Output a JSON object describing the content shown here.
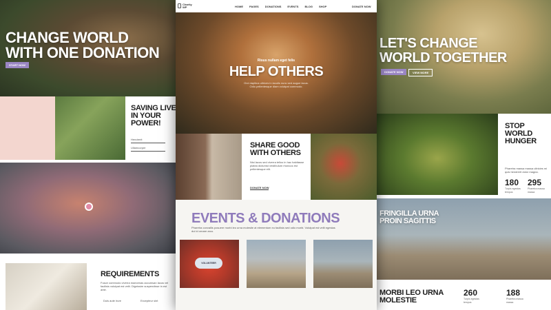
{
  "left": {
    "hero_title": "CHANGE WORLD\nWITH ONE DONATION",
    "hero_btn": "START NOW",
    "saving_title": "SAVING LIVE\nIN YOUR\nPOWER!",
    "field1": "Hendrerit",
    "field2": "Ullamcorper",
    "req_title": "REQUIREMENTS",
    "req_text": "Fusce commodo viverra maecenas accumsan lacus vel facilisis volutpat est velit. Dignissim suspendisse in est ante.",
    "bullet1": "Duis aute irure",
    "bullet2": "Excepteur sint"
  },
  "center": {
    "logo_line1": "Charity",
    "logo_line2": "WP",
    "nav": [
      "HOME",
      "PAGES",
      "DONATIONS",
      "EVENTS",
      "BLOG",
      "SHOP"
    ],
    "donate": "DONATE NOW",
    "hero_eyebrow": "Risus nullam eget felis",
    "hero_title": "HELP OTHERS",
    "hero_text": "Orci dapibus ultrices in iaculis nunc sed augue lacus. Odio pellentesque diam volutpat commodo.",
    "share_title": "SHARE GOOD\nWITH OTHERS",
    "share_text": "Nisi lacus sed viverra tellus in hac habitasse platea dictumst vestibulum rhoncus est pellentesque elit.",
    "share_btn": "DONATE NOW",
    "events_title": "EVENTS & DONATIONS",
    "events_text": "Pharetra convallis posuere morbi leo urna molestie at elementum eu facilisis sed odio morbi. Volutpat est velit egestas dui id ornare arcu.",
    "volunteer": "VOLUNTEER"
  },
  "right": {
    "hero_title": "LET'S CHANGE\nWORLD TOGETHER",
    "hero_btn1": "DONATE NOW",
    "hero_btn2": "VIEW MORE",
    "hunger_title": "STOP\nWORLD\nHUNGER",
    "hunger_text": "Pharetra massa massa ultricies mi quis hendrerit dolor magna.",
    "stat1_num": "180",
    "stat1_lbl": "Turpis egestas tempus",
    "stat2_num": "295",
    "stat2_lbl": "Pharetra massa massa",
    "fringilla_title": "FRINGILLA URNA\nPROIN SAGITTIS",
    "morbi_title": "MORBI LEO URNA\nMOLESTIE",
    "stat3_num": "260",
    "stat3_lbl": "Turpis egestas tempus",
    "stat4_num": "188",
    "stat4_lbl": "Pharetra massa massa"
  },
  "colors": {
    "accent_purple": "#9a86c4",
    "heart_pink": "#f3d6cf",
    "heart_stroke": "#e98a7c"
  }
}
